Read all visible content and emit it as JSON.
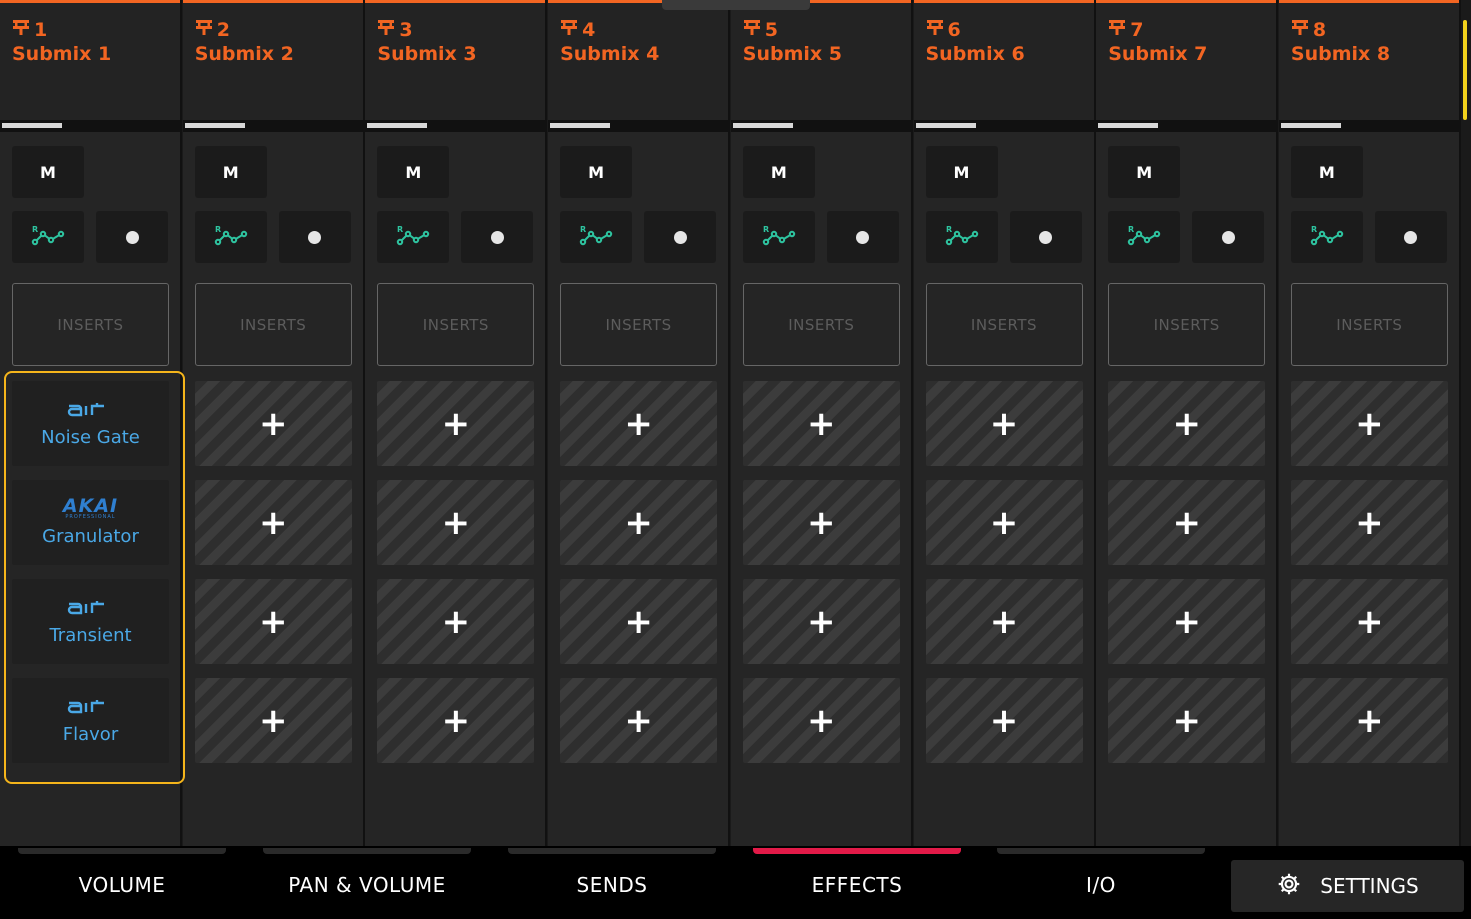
{
  "channels": [
    {
      "number": "1",
      "name": "Submix 1",
      "mute_label": "M",
      "inserts_label": "INSERTS",
      "slots": [
        {
          "vendor": "air",
          "name": "Noise Gate"
        },
        {
          "vendor": "akai",
          "name": "Granulator"
        },
        {
          "vendor": "air",
          "name": "Transient"
        },
        {
          "vendor": "air",
          "name": "Flavor"
        }
      ]
    },
    {
      "number": "2",
      "name": "Submix 2",
      "mute_label": "M",
      "inserts_label": "INSERTS",
      "slots": [
        null,
        null,
        null,
        null
      ]
    },
    {
      "number": "3",
      "name": "Submix 3",
      "mute_label": "M",
      "inserts_label": "INSERTS",
      "slots": [
        null,
        null,
        null,
        null
      ]
    },
    {
      "number": "4",
      "name": "Submix 4",
      "mute_label": "M",
      "inserts_label": "INSERTS",
      "slots": [
        null,
        null,
        null,
        null
      ]
    },
    {
      "number": "5",
      "name": "Submix 5",
      "mute_label": "M",
      "inserts_label": "INSERTS",
      "slots": [
        null,
        null,
        null,
        null
      ]
    },
    {
      "number": "6",
      "name": "Submix 6",
      "mute_label": "M",
      "inserts_label": "INSERTS",
      "slots": [
        null,
        null,
        null,
        null
      ]
    },
    {
      "number": "7",
      "name": "Submix 7",
      "mute_label": "M",
      "inserts_label": "INSERTS",
      "slots": [
        null,
        null,
        null,
        null
      ]
    },
    {
      "number": "8",
      "name": "Submix 8",
      "mute_label": "M",
      "inserts_label": "INSERTS",
      "slots": [
        null,
        null,
        null,
        null
      ]
    }
  ],
  "vendor_logos": {
    "air": "air",
    "akai": {
      "word": "AKAI",
      "sub": "PROFESSIONAL"
    }
  },
  "icons": {
    "channel": "submix-icon",
    "automation": "automation-read-icon",
    "record": "record-arm-icon",
    "empty_slot": "plus-icon",
    "settings": "gear-icon"
  },
  "tabs": [
    {
      "label": "VOLUME",
      "active": false
    },
    {
      "label": "PAN & VOLUME",
      "active": false
    },
    {
      "label": "SENDS",
      "active": false
    },
    {
      "label": "EFFECTS",
      "active": true
    },
    {
      "label": "I/O",
      "active": false
    }
  ],
  "settings_label": "SETTINGS",
  "colors": {
    "accent_orange": "#f26522",
    "plugin_blue": "#4aa8e6",
    "automation_green": "#2ec4a0",
    "active_tab": "#e21a48",
    "highlight": "#f5b51b"
  }
}
